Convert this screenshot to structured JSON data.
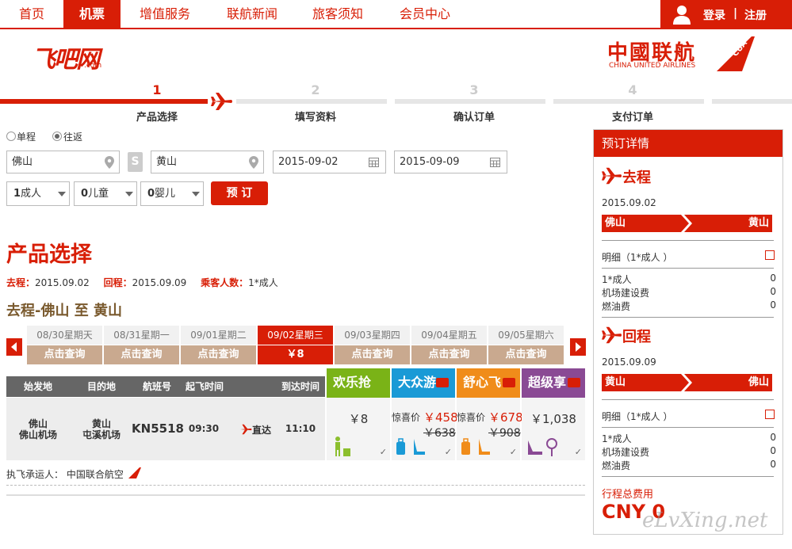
{
  "nav": {
    "items": [
      "首页",
      "机票",
      "增值服务",
      "联航新闻",
      "旅客须知",
      "会员中心"
    ],
    "active_index": 1,
    "login": "登录",
    "sep": "|",
    "register": "注册"
  },
  "brand": {
    "left_logo": "飞吧网",
    "left_logo_sub": ".com",
    "right_logo_cn": "中國联航",
    "right_logo_en": "CHINA UNITED AIRLINES",
    "right_logo_mark": "CUA"
  },
  "steps": [
    {
      "num": "1",
      "label": "产品选择"
    },
    {
      "num": "2",
      "label": "填写资料"
    },
    {
      "num": "3",
      "label": "确认订单"
    },
    {
      "num": "4",
      "label": "支付订单"
    }
  ],
  "search": {
    "trip_oneway": "单程",
    "trip_round": "往返",
    "selected_trip": "往返",
    "from": "佛山",
    "to": "黄山",
    "depart_date": "2015-09-02",
    "return_date": "2015-09-09",
    "adult": {
      "count": "1",
      "label": "成人"
    },
    "child": {
      "count": "0",
      "label": "儿童"
    },
    "infant": {
      "count": "0",
      "label": "婴儿"
    },
    "book_button": "预 订"
  },
  "product": {
    "heading": "产品选择",
    "summary": {
      "depart_label": "去程：",
      "depart_value": "2015.09.02",
      "return_label": "回程：",
      "return_value": "2015.09.09",
      "pax_label": "乘客人数：",
      "pax_value": "1*成人"
    },
    "route_title": "去程-佛山 至 黄山"
  },
  "date_tabs": [
    {
      "date": "08/30星期天",
      "query": "点击查询"
    },
    {
      "date": "08/31星期一",
      "query": "点击查询"
    },
    {
      "date": "09/01星期二",
      "query": "点击查询"
    },
    {
      "date": "09/02星期三",
      "query": "￥8"
    },
    {
      "date": "09/03星期四",
      "query": "点击查询"
    },
    {
      "date": "09/04星期五",
      "query": "点击查询"
    },
    {
      "date": "09/05星期六",
      "query": "点击查询"
    }
  ],
  "date_tab_active": 3,
  "table": {
    "headers": [
      "始发地",
      "目的地",
      "航班号",
      "起飞时间",
      "到达时间"
    ],
    "fare_headers": [
      {
        "label": "欢乐抢",
        "color": "#7ab317"
      },
      {
        "label": "大众游",
        "color": "#1a9ad6"
      },
      {
        "label": "舒心飞",
        "color": "#f08c1a"
      },
      {
        "label": "超级享",
        "color": "#8a4a94"
      }
    ],
    "row": {
      "from_city": "佛山",
      "from_airport": "佛山机场",
      "to_city": "黄山",
      "to_airport": "屯溪机场",
      "flight_no": "KN5518",
      "dep_time": "09:30",
      "direct": "直达",
      "arr_time": "11:10",
      "fares": [
        {
          "promo": "",
          "price": "￥8",
          "orig": ""
        },
        {
          "promo": "惊喜价",
          "price": "￥458",
          "orig": "￥638"
        },
        {
          "promo": "惊喜价",
          "price": "￥678",
          "orig": "￥908"
        },
        {
          "promo": "",
          "price": "￥1,038",
          "orig": ""
        }
      ]
    },
    "carrier_label": "执飞承运人：",
    "carrier_value": "中国联合航空"
  },
  "sidebar": {
    "title": "预订详情",
    "outbound": {
      "title": "去程",
      "date": "2015.09.02",
      "from": "佛山",
      "to": "黄山",
      "detail_label": "明细（1*成人 ）",
      "items": [
        {
          "label": "1*成人",
          "value": "0"
        },
        {
          "label": "机场建设费",
          "value": "0"
        },
        {
          "label": "燃油费",
          "value": "0"
        }
      ]
    },
    "inbound": {
      "title": "回程",
      "date": "2015.09.09",
      "from": "黄山",
      "to": "佛山",
      "detail_label": "明细（1*成人 ）",
      "items": [
        {
          "label": "1*成人",
          "value": "0"
        },
        {
          "label": "机场建设费",
          "value": "0"
        },
        {
          "label": "燃油费",
          "value": "0"
        }
      ]
    },
    "total_label": "行程总费用",
    "total_value": "CNY 0"
  },
  "watermark": "eLvXing.net",
  "colors": {
    "brand_red": "#d81e06",
    "query_tan": "#c9a98f"
  }
}
